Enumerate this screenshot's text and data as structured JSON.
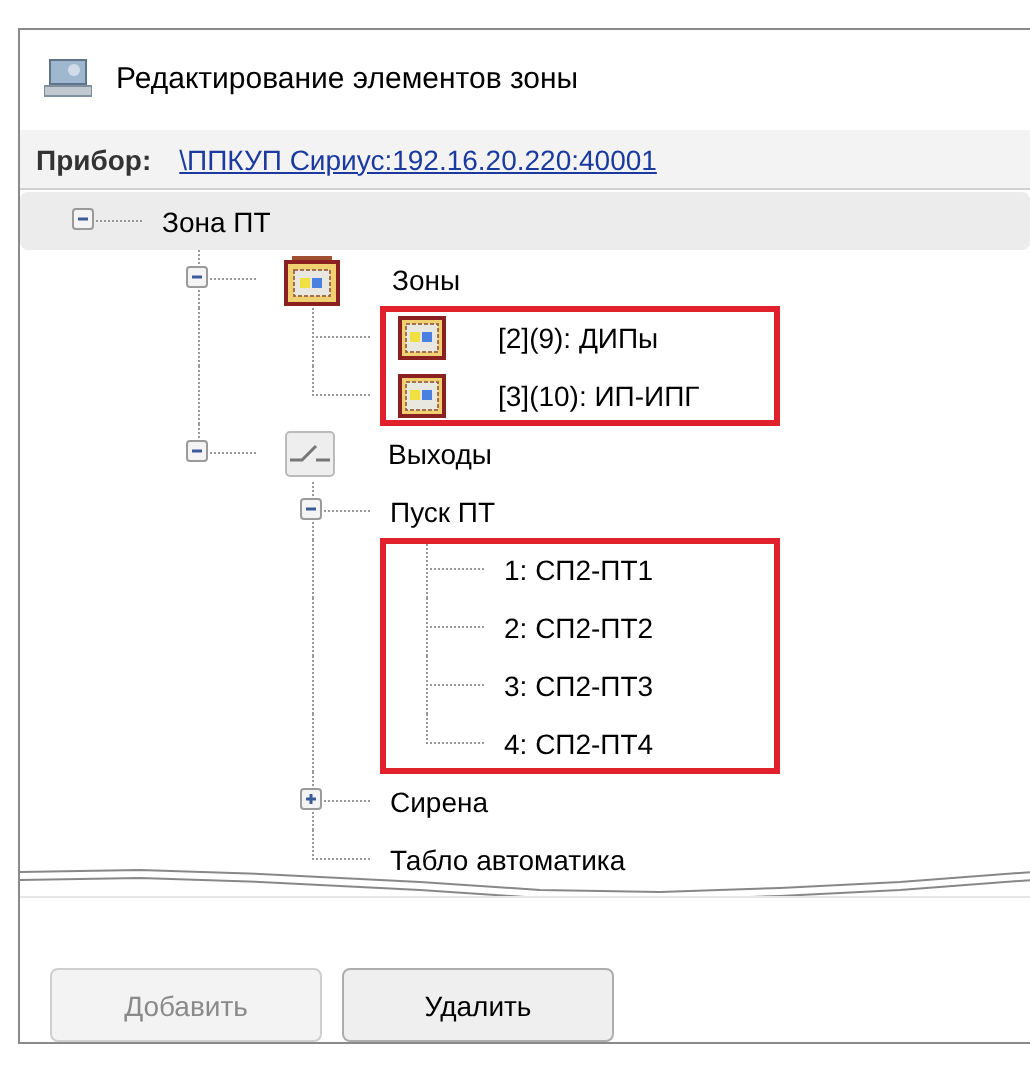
{
  "window": {
    "title": "Редактирование элементов зоны"
  },
  "device": {
    "label": "Прибор:",
    "link": "\\ППКУП Сириус:192.16.20.220:40001"
  },
  "tree": [
    {
      "label": "Зона ПТ",
      "expanded": true,
      "selected": true,
      "children": [
        {
          "label": "Зоны",
          "kind": "zone-group",
          "expanded": true,
          "selected": false,
          "highlighted": true,
          "children": [
            {
              "label": "[2](9): ДИПы",
              "kind": "zone",
              "selected": false
            },
            {
              "label": "[3](10): ИП-ИПГ",
              "kind": "zone",
              "selected": false
            }
          ]
        },
        {
          "label": "Выходы",
          "kind": "output",
          "expanded": true,
          "selected": false,
          "children": [
            {
              "label": "Пуск ПТ",
              "expanded": true,
              "selected": false,
              "highlighted": true,
              "children": [
                {
                  "label": "1: СП2-ПТ1",
                  "selected": false
                },
                {
                  "label": "2: СП2-ПТ2",
                  "selected": false
                },
                {
                  "label": "3: СП2-ПТ3",
                  "selected": false
                },
                {
                  "label": "4: СП2-ПТ4",
                  "selected": false
                }
              ]
            },
            {
              "label": "Сирена",
              "expanded": false,
              "selected": false
            },
            {
              "label": "Табло автоматика",
              "selected": false
            }
          ]
        }
      ]
    }
  ],
  "buttons": [
    {
      "label": "Добавить",
      "disabled": true
    },
    {
      "label": "Удалить",
      "disabled": false
    }
  ]
}
